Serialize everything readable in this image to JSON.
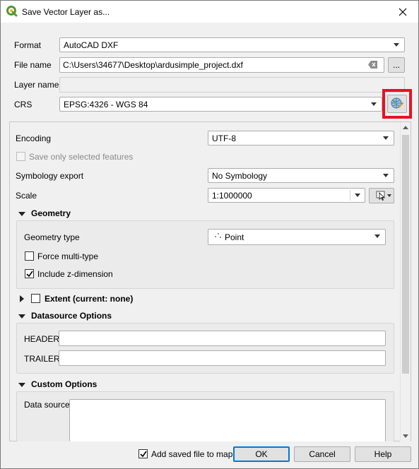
{
  "window": {
    "title": "Save Vector Layer as..."
  },
  "form": {
    "format_label": "Format",
    "format_value": "AutoCAD DXF",
    "filename_label": "File name",
    "filename_value": "C:\\Users\\34677\\Desktop\\ardusimple_project.dxf",
    "browse_label": "...",
    "layername_label": "Layer name",
    "layername_value": "",
    "crs_label": "CRS",
    "crs_value": "EPSG:4326 - WGS 84"
  },
  "options": {
    "encoding_label": "Encoding",
    "encoding_value": "UTF-8",
    "save_selected_label": "Save only selected features",
    "symbology_label": "Symbology export",
    "symbology_value": "No Symbology",
    "scale_label": "Scale",
    "scale_value": "1:1000000"
  },
  "geometry": {
    "header": "Geometry",
    "type_label": "Geometry type",
    "type_value": "Point",
    "force_multi_label": "Force multi-type",
    "force_multi_checked": false,
    "zdim_label": "Include z-dimension",
    "zdim_checked": true
  },
  "extent": {
    "header": "Extent (current: none)"
  },
  "datasource": {
    "header": "Datasource Options",
    "header_field_label": "HEADER",
    "header_field_value": "",
    "trailer_field_label": "TRAILER",
    "trailer_field_value": ""
  },
  "custom": {
    "header": "Custom Options",
    "datasource_label": "Data source",
    "datasource_value": ""
  },
  "footer": {
    "add_saved_label": "Add saved file to map",
    "add_saved_checked": true,
    "ok_label": "OK",
    "cancel_label": "Cancel",
    "help_label": "Help"
  },
  "colors": {
    "highlight": "#e81123",
    "focus": "#0078d7",
    "qgis_green": "#589632",
    "qgis_yellow": "#eeb923"
  },
  "icons": {
    "app": "qgis-logo-icon",
    "close": "close-icon",
    "crs": "crs-globe-icon",
    "clear": "clear-text-icon",
    "map_tool": "map-pick-icon",
    "point": "point-geometry-icon"
  }
}
